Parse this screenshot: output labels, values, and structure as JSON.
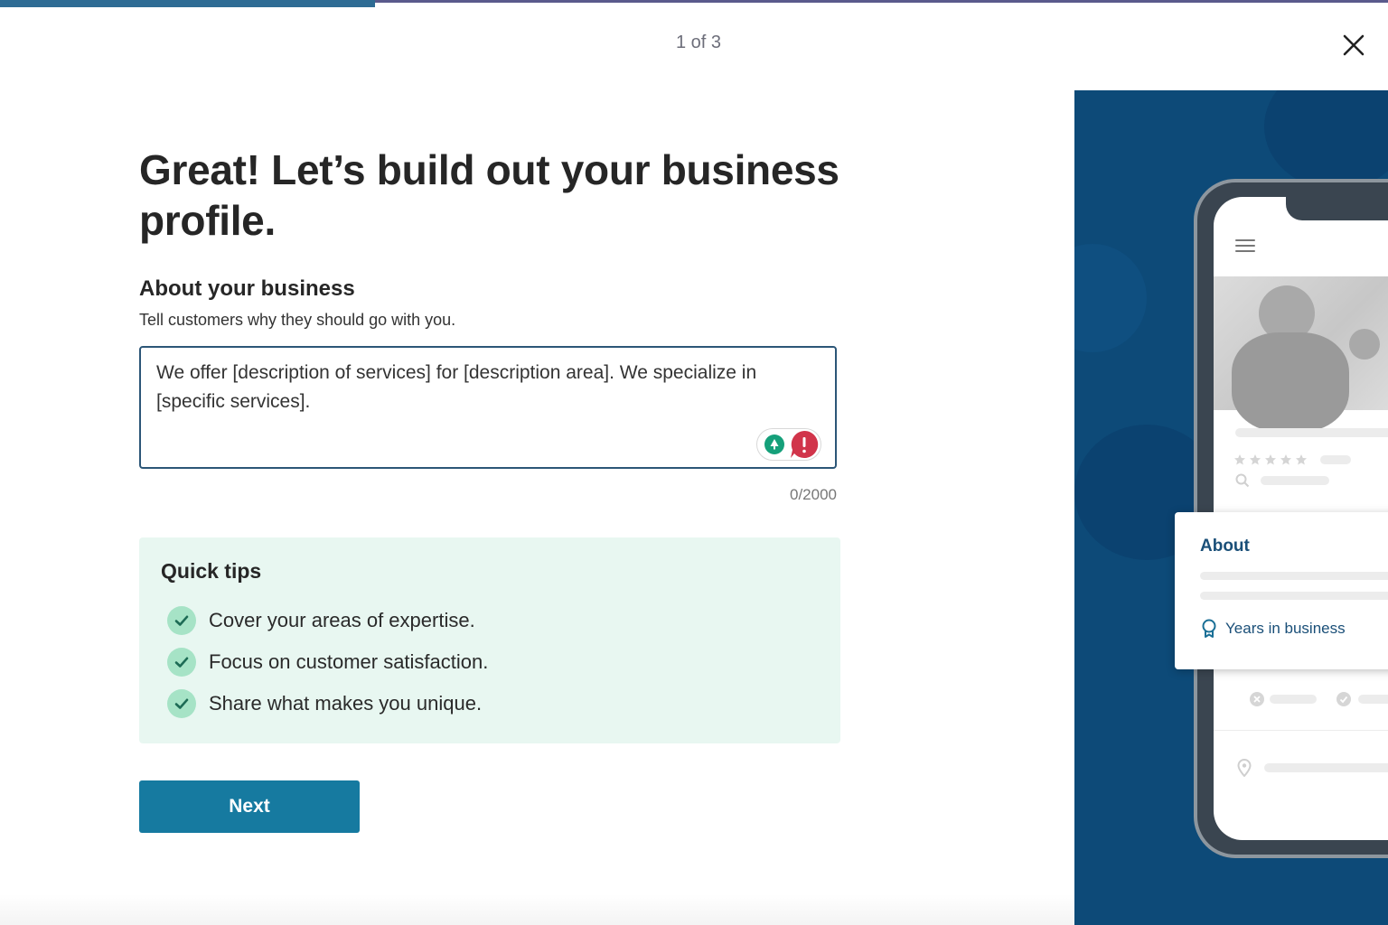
{
  "progress": {
    "fraction": 0.27,
    "step_label": "1 of 3"
  },
  "icons": {
    "close": "close-icon",
    "grammar": "grammar-check-icon",
    "alert": "alert-icon",
    "check": "check-icon",
    "menu": "menu-icon",
    "award": "award-icon",
    "location": "location-pin-icon"
  },
  "page": {
    "title": "Great! Let’s build out your business profile.",
    "section_heading": "About your business",
    "section_subtitle": "Tell customers why they should go with you.",
    "description_value": "We offer [description of services] for [description area]. We specialize in [specific services].",
    "char_count": "0/2000",
    "tips": {
      "title": "Quick tips",
      "items": [
        "Cover your areas of expertise.",
        "Focus on customer satisfaction.",
        "Share what makes you unique."
      ]
    },
    "next_label": "Next"
  },
  "preview": {
    "about_title": "About",
    "years_label": "Years in business"
  },
  "colors": {
    "accent": "#167aa0",
    "illustration_bg": "#0d4a78",
    "tips_bg": "#e8f7f1",
    "alert": "#d1344a",
    "grammar": "#15a07a"
  }
}
